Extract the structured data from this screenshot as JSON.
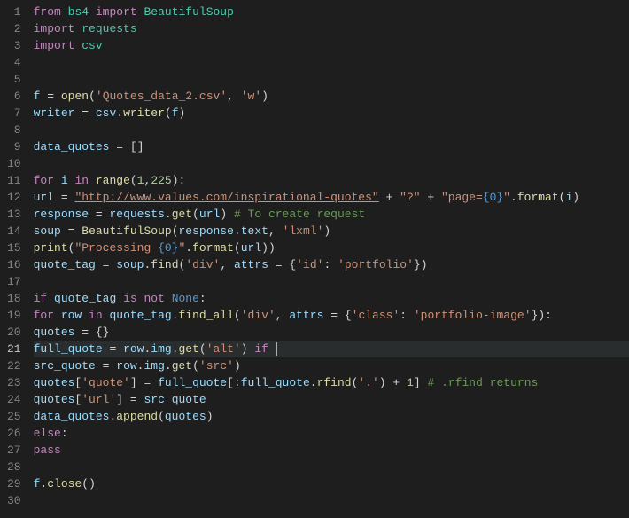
{
  "editor": {
    "current_line": 21,
    "lines": [
      {
        "n": 1,
        "tokens": [
          [
            "keyword",
            "from"
          ],
          [
            "sp",
            " "
          ],
          [
            "module",
            "bs4"
          ],
          [
            "sp",
            " "
          ],
          [
            "keyword",
            "import"
          ],
          [
            "sp",
            " "
          ],
          [
            "module",
            "BeautifulSoup"
          ]
        ]
      },
      {
        "n": 2,
        "tokens": [
          [
            "keyword",
            "import"
          ],
          [
            "sp",
            " "
          ],
          [
            "module",
            "requests"
          ]
        ]
      },
      {
        "n": 3,
        "tokens": [
          [
            "keyword",
            "import"
          ],
          [
            "sp",
            " "
          ],
          [
            "module",
            "csv"
          ]
        ]
      },
      {
        "n": 4,
        "tokens": []
      },
      {
        "n": 5,
        "tokens": []
      },
      {
        "n": 6,
        "tokens": [
          [
            "var",
            "f"
          ],
          [
            "sp",
            " "
          ],
          [
            "op",
            "="
          ],
          [
            "sp",
            " "
          ],
          [
            "func",
            "open"
          ],
          [
            "punct",
            "("
          ],
          [
            "string",
            "'Quotes_data_2.csv'"
          ],
          [
            "punct",
            ","
          ],
          [
            "sp",
            " "
          ],
          [
            "string",
            "'w'"
          ],
          [
            "punct",
            ")"
          ]
        ]
      },
      {
        "n": 7,
        "tokens": [
          [
            "var",
            "writer"
          ],
          [
            "sp",
            " "
          ],
          [
            "op",
            "="
          ],
          [
            "sp",
            " "
          ],
          [
            "var",
            "csv"
          ],
          [
            "punct",
            "."
          ],
          [
            "func",
            "writer"
          ],
          [
            "punct",
            "("
          ],
          [
            "var",
            "f"
          ],
          [
            "punct",
            ")"
          ]
        ]
      },
      {
        "n": 8,
        "tokens": []
      },
      {
        "n": 9,
        "tokens": [
          [
            "var",
            "data_quotes"
          ],
          [
            "sp",
            " "
          ],
          [
            "op",
            "="
          ],
          [
            "sp",
            " "
          ],
          [
            "punct",
            "["
          ],
          [
            "punct",
            "]"
          ]
        ]
      },
      {
        "n": 10,
        "tokens": []
      },
      {
        "n": 11,
        "tokens": [
          [
            "keyword",
            "for"
          ],
          [
            "sp",
            " "
          ],
          [
            "var",
            "i"
          ],
          [
            "sp",
            " "
          ],
          [
            "keyword",
            "in"
          ],
          [
            "sp",
            " "
          ],
          [
            "func",
            "range"
          ],
          [
            "punct",
            "("
          ],
          [
            "number",
            "1"
          ],
          [
            "punct",
            ","
          ],
          [
            "number",
            "225"
          ],
          [
            "punct",
            ")"
          ],
          [
            "punct",
            ":"
          ]
        ]
      },
      {
        "n": 12,
        "tokens": [
          [
            "indent",
            "    "
          ],
          [
            "var",
            "url"
          ],
          [
            "sp",
            " "
          ],
          [
            "op",
            "="
          ],
          [
            "sp",
            " "
          ],
          [
            "string-u",
            "\"http://www.values.com/inspirational-quotes\""
          ],
          [
            "sp",
            " "
          ],
          [
            "op",
            "+"
          ],
          [
            "sp",
            " "
          ],
          [
            "string",
            "\"?\""
          ],
          [
            "sp",
            " "
          ],
          [
            "op",
            "+"
          ],
          [
            "sp",
            " "
          ],
          [
            "string",
            "\"page="
          ],
          [
            "const",
            "{0}"
          ],
          [
            "string",
            "\""
          ],
          [
            "punct",
            "."
          ],
          [
            "func",
            "format"
          ],
          [
            "punct",
            "("
          ],
          [
            "var",
            "i"
          ],
          [
            "punct",
            ")"
          ]
        ]
      },
      {
        "n": 13,
        "tokens": [
          [
            "indent",
            "    "
          ],
          [
            "var",
            "response"
          ],
          [
            "sp",
            " "
          ],
          [
            "op",
            "="
          ],
          [
            "sp",
            " "
          ],
          [
            "var",
            "requests"
          ],
          [
            "punct",
            "."
          ],
          [
            "func",
            "get"
          ],
          [
            "punct",
            "("
          ],
          [
            "var",
            "url"
          ],
          [
            "punct",
            ")"
          ],
          [
            "sp",
            "    "
          ],
          [
            "comment",
            "# To create request"
          ]
        ]
      },
      {
        "n": 14,
        "tokens": [
          [
            "indent",
            "    "
          ],
          [
            "var",
            "soup"
          ],
          [
            "sp",
            " "
          ],
          [
            "op",
            "="
          ],
          [
            "sp",
            " "
          ],
          [
            "func",
            "BeautifulSoup"
          ],
          [
            "punct",
            "("
          ],
          [
            "var",
            "response"
          ],
          [
            "punct",
            "."
          ],
          [
            "var",
            "text"
          ],
          [
            "punct",
            ","
          ],
          [
            "sp",
            " "
          ],
          [
            "string",
            "'lxml'"
          ],
          [
            "punct",
            ")"
          ]
        ]
      },
      {
        "n": 15,
        "tokens": [
          [
            "indent",
            "    "
          ],
          [
            "func",
            "print"
          ],
          [
            "punct",
            "("
          ],
          [
            "string",
            "\"Processing "
          ],
          [
            "const",
            "{0}"
          ],
          [
            "string",
            "\""
          ],
          [
            "punct",
            "."
          ],
          [
            "func",
            "format"
          ],
          [
            "punct",
            "("
          ],
          [
            "var",
            "url"
          ],
          [
            "punct",
            ")"
          ],
          [
            "punct",
            ")"
          ]
        ]
      },
      {
        "n": 16,
        "tokens": [
          [
            "indent",
            "    "
          ],
          [
            "var",
            "quote_tag"
          ],
          [
            "sp",
            " "
          ],
          [
            "op",
            "="
          ],
          [
            "sp",
            " "
          ],
          [
            "var",
            "soup"
          ],
          [
            "punct",
            "."
          ],
          [
            "func",
            "find"
          ],
          [
            "punct",
            "("
          ],
          [
            "string",
            "'div'"
          ],
          [
            "punct",
            ","
          ],
          [
            "sp",
            " "
          ],
          [
            "var",
            "attrs"
          ],
          [
            "sp",
            " "
          ],
          [
            "op",
            "="
          ],
          [
            "sp",
            " "
          ],
          [
            "punct",
            "{"
          ],
          [
            "string",
            "'id'"
          ],
          [
            "punct",
            ":"
          ],
          [
            "sp",
            " "
          ],
          [
            "string",
            "'portfolio'"
          ],
          [
            "punct",
            "}"
          ],
          [
            "punct",
            ")"
          ]
        ]
      },
      {
        "n": 17,
        "tokens": []
      },
      {
        "n": 18,
        "tokens": [
          [
            "indent",
            "    "
          ],
          [
            "keyword",
            "if"
          ],
          [
            "sp",
            " "
          ],
          [
            "var",
            "quote_tag"
          ],
          [
            "sp",
            " "
          ],
          [
            "keyword",
            "is"
          ],
          [
            "sp",
            " "
          ],
          [
            "keyword",
            "not"
          ],
          [
            "sp",
            " "
          ],
          [
            "const",
            "None"
          ],
          [
            "punct",
            ":"
          ]
        ]
      },
      {
        "n": 19,
        "tokens": [
          [
            "indent",
            "        "
          ],
          [
            "keyword",
            "for"
          ],
          [
            "sp",
            " "
          ],
          [
            "var",
            "row"
          ],
          [
            "sp",
            " "
          ],
          [
            "keyword",
            "in"
          ],
          [
            "sp",
            " "
          ],
          [
            "var",
            "quote_tag"
          ],
          [
            "punct",
            "."
          ],
          [
            "func",
            "find_all"
          ],
          [
            "punct",
            "("
          ],
          [
            "string",
            "'div'"
          ],
          [
            "punct",
            ","
          ],
          [
            "sp",
            " "
          ],
          [
            "var",
            "attrs"
          ],
          [
            "sp",
            " "
          ],
          [
            "op",
            "="
          ],
          [
            "sp",
            " "
          ],
          [
            "punct",
            "{"
          ],
          [
            "string",
            "'class'"
          ],
          [
            "punct",
            ":"
          ],
          [
            "sp",
            " "
          ],
          [
            "string",
            "'portfolio-image'"
          ],
          [
            "punct",
            "}"
          ],
          [
            "punct",
            ")"
          ],
          [
            "punct",
            ":"
          ]
        ]
      },
      {
        "n": 20,
        "tokens": [
          [
            "indent",
            "            "
          ],
          [
            "var",
            "quotes"
          ],
          [
            "sp",
            " "
          ],
          [
            "op",
            "="
          ],
          [
            "sp",
            " "
          ],
          [
            "punct",
            "{"
          ],
          [
            "punct",
            "}"
          ]
        ]
      },
      {
        "n": 21,
        "tokens": [
          [
            "indent",
            "            "
          ],
          [
            "var",
            "full_quote"
          ],
          [
            "sp",
            " "
          ],
          [
            "op",
            "="
          ],
          [
            "sp",
            " "
          ],
          [
            "var",
            "row"
          ],
          [
            "punct",
            "."
          ],
          [
            "var",
            "img"
          ],
          [
            "punct",
            "."
          ],
          [
            "func",
            "get"
          ],
          [
            "punct",
            "("
          ],
          [
            "string",
            "'alt'"
          ],
          [
            "punct",
            ")"
          ],
          [
            "sp",
            " "
          ],
          [
            "keyword",
            "if"
          ],
          [
            "sp",
            " "
          ],
          [
            "cursor",
            ""
          ]
        ],
        "current": true
      },
      {
        "n": 22,
        "tokens": [
          [
            "indent",
            "            "
          ],
          [
            "var",
            "src_quote"
          ],
          [
            "sp",
            " "
          ],
          [
            "op",
            "="
          ],
          [
            "sp",
            " "
          ],
          [
            "var",
            "row"
          ],
          [
            "punct",
            "."
          ],
          [
            "var",
            "img"
          ],
          [
            "punct",
            "."
          ],
          [
            "func",
            "get"
          ],
          [
            "punct",
            "("
          ],
          [
            "string",
            "'src'"
          ],
          [
            "punct",
            ")"
          ]
        ]
      },
      {
        "n": 23,
        "tokens": [
          [
            "indent",
            "            "
          ],
          [
            "var",
            "quotes"
          ],
          [
            "punct",
            "["
          ],
          [
            "string",
            "'quote'"
          ],
          [
            "punct",
            "]"
          ],
          [
            "sp",
            " "
          ],
          [
            "op",
            "="
          ],
          [
            "sp",
            " "
          ],
          [
            "var",
            "full_quote"
          ],
          [
            "punct",
            "["
          ],
          [
            "punct",
            ":"
          ],
          [
            "var",
            "full_quote"
          ],
          [
            "punct",
            "."
          ],
          [
            "func",
            "rfind"
          ],
          [
            "punct",
            "("
          ],
          [
            "string",
            "'.'"
          ],
          [
            "punct",
            ")"
          ],
          [
            "sp",
            " "
          ],
          [
            "op",
            "+"
          ],
          [
            "sp",
            " "
          ],
          [
            "number",
            "1"
          ],
          [
            "punct",
            "]"
          ],
          [
            "sp",
            " "
          ],
          [
            "comment",
            "# .rfind returns"
          ]
        ]
      },
      {
        "n": 24,
        "tokens": [
          [
            "indent",
            "            "
          ],
          [
            "var",
            "quotes"
          ],
          [
            "punct",
            "["
          ],
          [
            "string",
            "'url'"
          ],
          [
            "punct",
            "]"
          ],
          [
            "sp",
            " "
          ],
          [
            "op",
            "="
          ],
          [
            "sp",
            " "
          ],
          [
            "var",
            "src_quote"
          ]
        ]
      },
      {
        "n": 25,
        "tokens": [
          [
            "indent",
            "            "
          ],
          [
            "var",
            "data_quotes"
          ],
          [
            "punct",
            "."
          ],
          [
            "func",
            "append"
          ],
          [
            "punct",
            "("
          ],
          [
            "var",
            "quotes"
          ],
          [
            "punct",
            ")"
          ]
        ]
      },
      {
        "n": 26,
        "tokens": [
          [
            "indent",
            "    "
          ],
          [
            "keyword",
            "else"
          ],
          [
            "punct",
            ":"
          ]
        ]
      },
      {
        "n": 27,
        "tokens": [
          [
            "indent",
            "        "
          ],
          [
            "keyword",
            "pass"
          ]
        ]
      },
      {
        "n": 28,
        "tokens": []
      },
      {
        "n": 29,
        "tokens": [
          [
            "var",
            "f"
          ],
          [
            "punct",
            "."
          ],
          [
            "func",
            "close"
          ],
          [
            "punct",
            "("
          ],
          [
            "punct",
            ")"
          ]
        ]
      },
      {
        "n": 30,
        "tokens": []
      }
    ]
  }
}
